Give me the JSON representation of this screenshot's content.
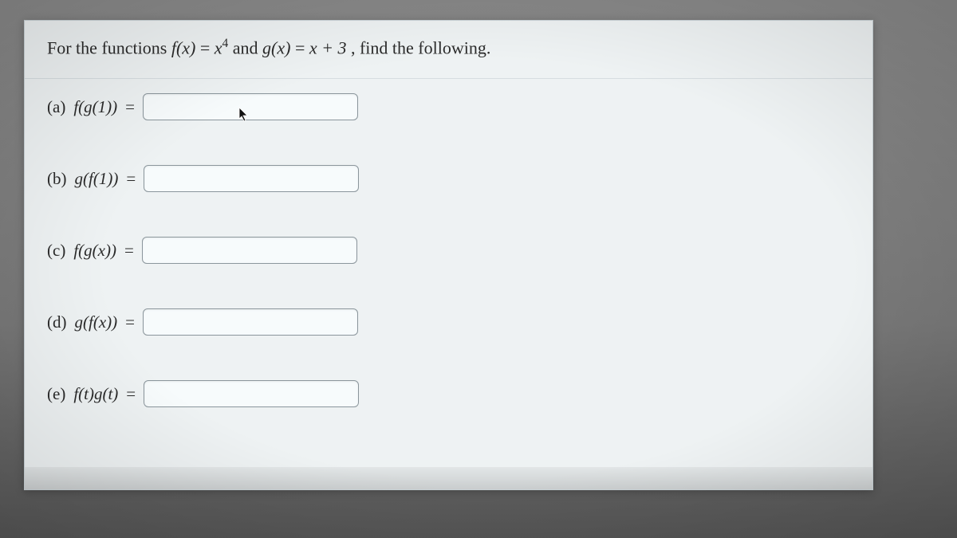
{
  "question": {
    "prefix": "For the functions ",
    "f_lhs": "f(x)",
    "f_rhs_base": "x",
    "f_rhs_exp": "4",
    "and_text": " and ",
    "g_lhs": "g(x)",
    "g_rhs": "x + 3",
    "suffix": ", find the following."
  },
  "parts": [
    {
      "label": "(a)",
      "expr": "f(g(1))",
      "eq": "="
    },
    {
      "label": "(b)",
      "expr": "g(f(1))",
      "eq": "="
    },
    {
      "label": "(c)",
      "expr": "f(g(x))",
      "eq": "="
    },
    {
      "label": "(d)",
      "expr": "g(f(x))",
      "eq": "="
    },
    {
      "label": "(e)",
      "expr": "f(t)g(t)",
      "eq": "="
    }
  ],
  "answers": [
    "",
    "",
    "",
    "",
    ""
  ]
}
